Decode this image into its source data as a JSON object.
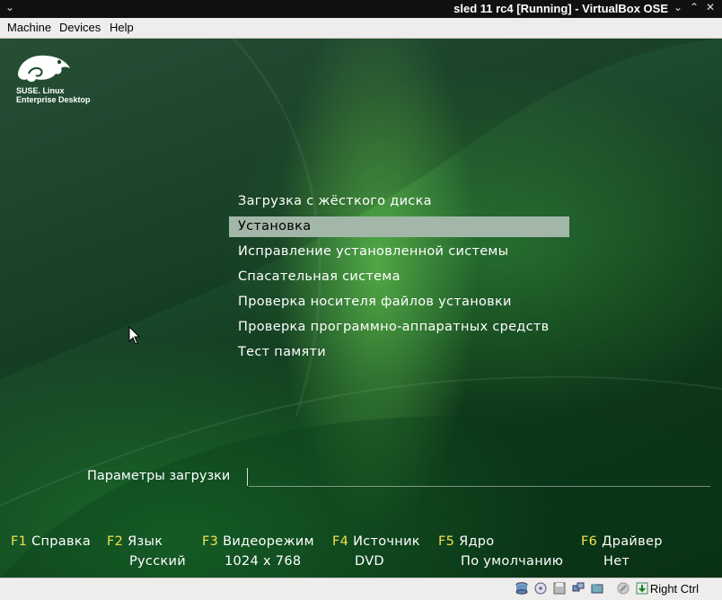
{
  "window": {
    "title": "sled 11 rc4 [Running] - VirtualBox OSE"
  },
  "menubar": {
    "machine": "Machine",
    "devices": "Devices",
    "help": "Help"
  },
  "logo": {
    "line1": "SUSE. Linux",
    "line2": "Enterprise Desktop"
  },
  "boot_menu": {
    "items": [
      "Загрузка с жёсткого диска",
      "Установка",
      "Исправление установленной системы",
      "Спасательная система",
      "Проверка носителя файлов установки",
      "Проверка программно-аппаратных средств",
      "Тест памяти"
    ],
    "selected_index": 1
  },
  "boot_options": {
    "label": "Параметры загрузки",
    "value": ""
  },
  "fkeys": [
    {
      "key": "F1",
      "label": "Справка",
      "value": ""
    },
    {
      "key": "F2",
      "label": "Язык",
      "value": "Русский"
    },
    {
      "key": "F3",
      "label": "Видеорежим",
      "value": "1024 x 768"
    },
    {
      "key": "F4",
      "label": "Источник",
      "value": "DVD"
    },
    {
      "key": "F5",
      "label": "Ядро",
      "value": "По умолчанию"
    },
    {
      "key": "F6",
      "label": "Драйвер",
      "value": "Нет"
    }
  ],
  "statusbar": {
    "host_key": "Right Ctrl",
    "icons": [
      "hard-disk-icon",
      "cd-icon",
      "floppy-icon",
      "network-icon",
      "shared-folder-icon",
      "usb-icon",
      "mouse-integration-icon"
    ]
  },
  "colors": {
    "fkey": "#f2e24a",
    "selected_bg": "#a3b7a8",
    "screen_bg": "#1c4a2c"
  }
}
